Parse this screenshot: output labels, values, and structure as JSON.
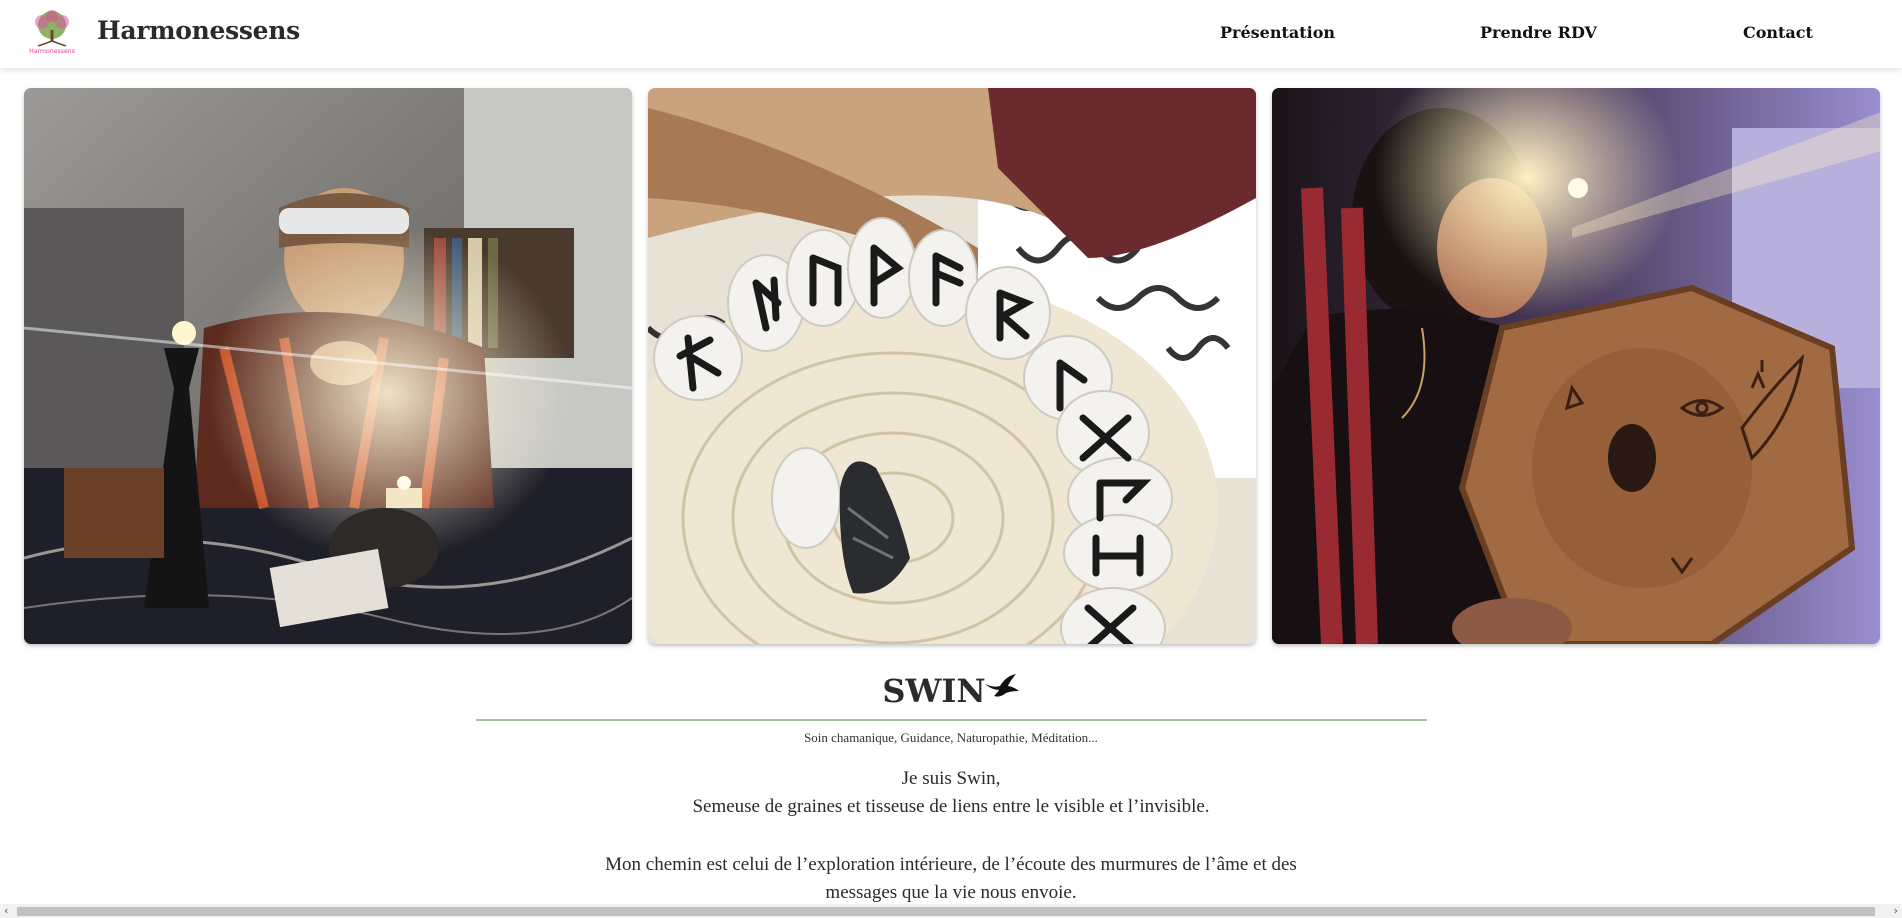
{
  "header": {
    "logo_text": "Harmonessens",
    "site_title": "Harmonessens",
    "nav": [
      {
        "label": "Présentation"
      },
      {
        "label": "Prendre RDV"
      },
      {
        "label": "Contact"
      }
    ]
  },
  "gallery": [
    {
      "icon": "photo-woman-candle-meditation"
    },
    {
      "icon": "photo-rune-stones"
    },
    {
      "icon": "photo-woman-shamanic-drum"
    }
  ],
  "content": {
    "title": "SWIN",
    "title_icon": "bird-icon",
    "subtitle": "Soin chamanique, Guidance, Naturopathie, Méditation...",
    "paragraph1_line1": "Je suis Swin,",
    "paragraph1_line2": "Semeuse de graines et tisseuse de liens entre le visible et l’invisible.",
    "paragraph2_line1": "Mon chemin est celui de l’exploration intérieure, de l’écoute des murmures de l’âme et des",
    "paragraph2_line2": "messages que la vie nous envoie."
  },
  "colors": {
    "divider": "#a5c397",
    "logo_pink": "#e2409b",
    "logo_green": "#5f8f3a"
  }
}
